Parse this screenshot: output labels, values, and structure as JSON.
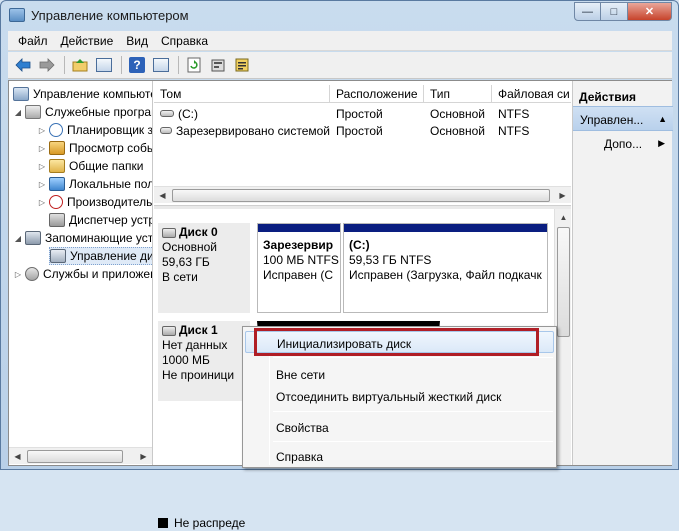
{
  "window": {
    "title": "Управление компьютером"
  },
  "window_buttons": {
    "minimize": "—",
    "maximize": "□",
    "close": "✕"
  },
  "menubar": [
    "Файл",
    "Действие",
    "Вид",
    "Справка"
  ],
  "toolbar": {
    "icons": [
      "back-arrow-icon",
      "forward-arrow-icon",
      "up-folder-icon",
      "show-hide-tree-icon",
      "help-icon",
      "properties-icon",
      "refresh-icon",
      "settings-icon",
      "export-icon"
    ],
    "help_glyph": "?"
  },
  "tree": {
    "items": [
      {
        "label": "Управление компьютером (локальным)",
        "icon": "computer-management-icon"
      },
      {
        "label": "Служебные программы",
        "icon": "tools-icon"
      },
      {
        "label": "Планировщик заданий",
        "icon": "clock-icon"
      },
      {
        "label": "Просмотр событий",
        "icon": "event-viewer-icon"
      },
      {
        "label": "Общие папки",
        "icon": "shared-folder-icon"
      },
      {
        "label": "Локальные пользователи",
        "icon": "users-icon"
      },
      {
        "label": "Производительность",
        "icon": "performance-icon"
      },
      {
        "label": "Диспетчер устройств",
        "icon": "device-manager-icon"
      },
      {
        "label": "Запоминающие устройства",
        "icon": "storage-icon"
      },
      {
        "label": "Управление дисками",
        "icon": "disk-management-icon"
      },
      {
        "label": "Службы и приложения",
        "icon": "services-icon"
      }
    ]
  },
  "volumes": {
    "columns": [
      "Том",
      "Расположение",
      "Тип",
      "Файловая си"
    ],
    "rows": [
      [
        "(C:)",
        "Простой",
        "Основной",
        "NTFS"
      ],
      [
        "Зарезервировано системой",
        "Простой",
        "Основной",
        "NTFS"
      ]
    ]
  },
  "disks": [
    {
      "title": "Диск 0",
      "type": "Основной",
      "size": "59,63 ГБ",
      "status": "В сети",
      "partitions": [
        {
          "name": "Зарезервир",
          "size": "100 МБ NTFS",
          "status": "Исправен (С"
        },
        {
          "name": "(C:)",
          "size": "59,53 ГБ NTFS",
          "status": "Исправен (Загрузка, Файл подкачк"
        }
      ]
    },
    {
      "title": "Диск 1",
      "type": "Нет данных",
      "size": "1000 МБ",
      "status": "Не проиници"
    }
  ],
  "legend": {
    "unallocated": "Не распреде"
  },
  "actions": {
    "header": "Действия",
    "section": "Управлен...",
    "items": [
      "Допо..."
    ],
    "arrow_up": "▲",
    "arrow_right": "▶"
  },
  "context_menu": {
    "items": [
      "Инициализировать диск",
      "Вне сети",
      "Отсоединить виртуальный жесткий диск",
      "Свойства",
      "Справка"
    ],
    "highlighted": "Инициализировать диск"
  },
  "colors": {
    "partition_bar": "#0a1e80",
    "highlight_outline": "#b01e26",
    "unallocated": "#000000"
  }
}
